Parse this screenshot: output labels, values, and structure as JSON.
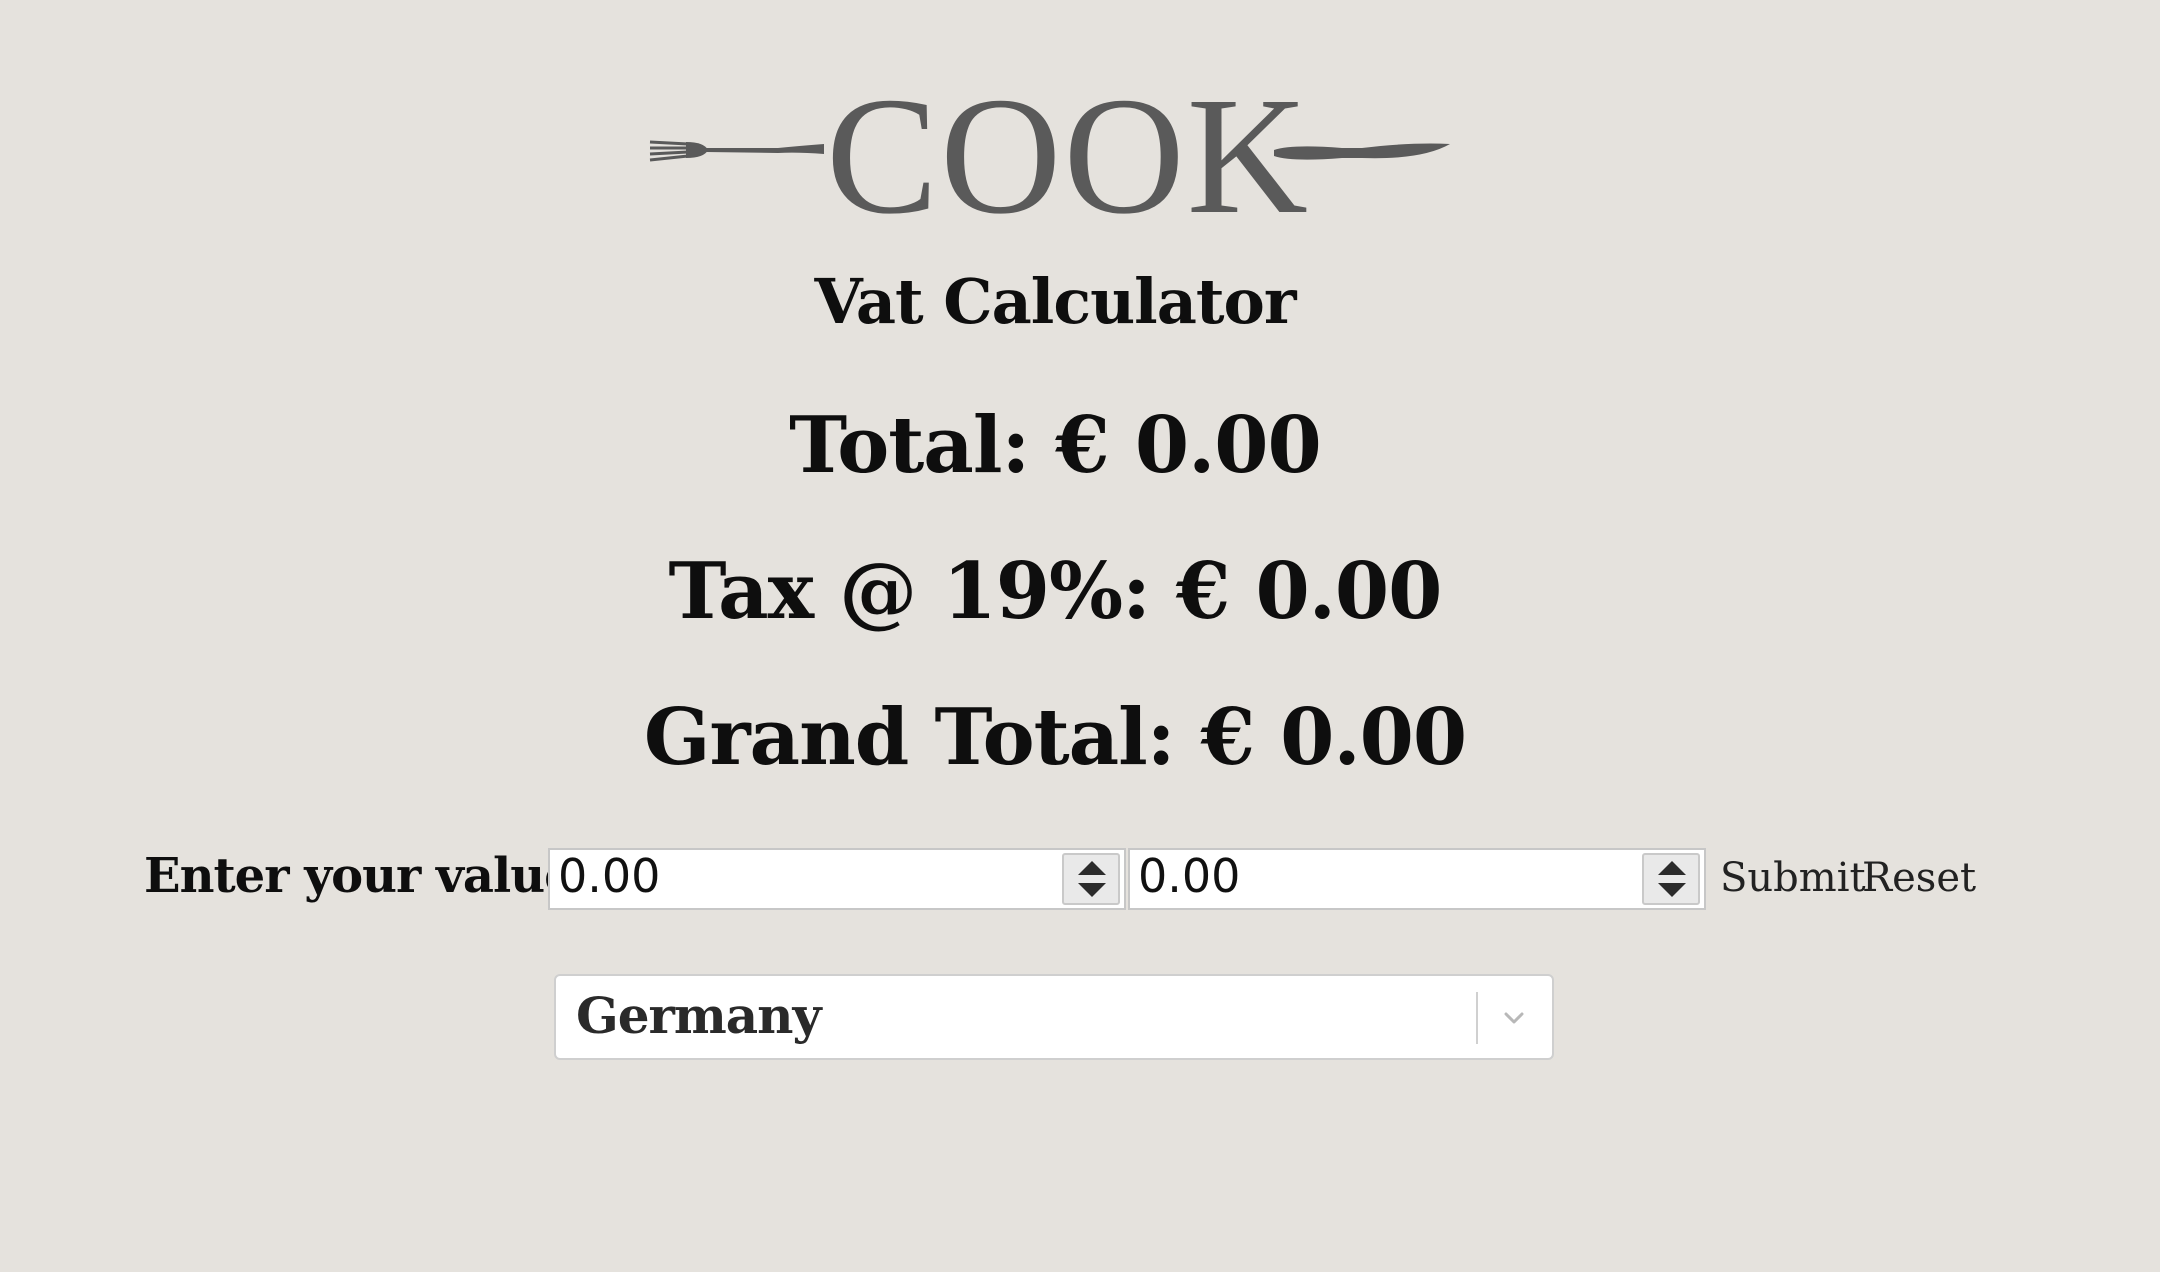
{
  "logo": {
    "text": "COOK",
    "left_icon": "fork-icon",
    "right_icon": "knife-icon",
    "color": "#5a5a5a"
  },
  "app_title": "Vat Calculator",
  "summary": {
    "total": "Total: € 0.00",
    "tax": "Tax @ 19%: € 0.00",
    "grand_total": "Grand Total: € 0.00"
  },
  "form": {
    "label": "Enter your values:",
    "value_1": "0.00",
    "value_2": "0.00",
    "submit_label": "Submit",
    "reset_label": "Reset"
  },
  "country_select": {
    "selected": "Germany",
    "icon": "chevron-down-icon"
  },
  "colors": {
    "background": "#e5e2dd",
    "text": "#0e0e0e"
  }
}
